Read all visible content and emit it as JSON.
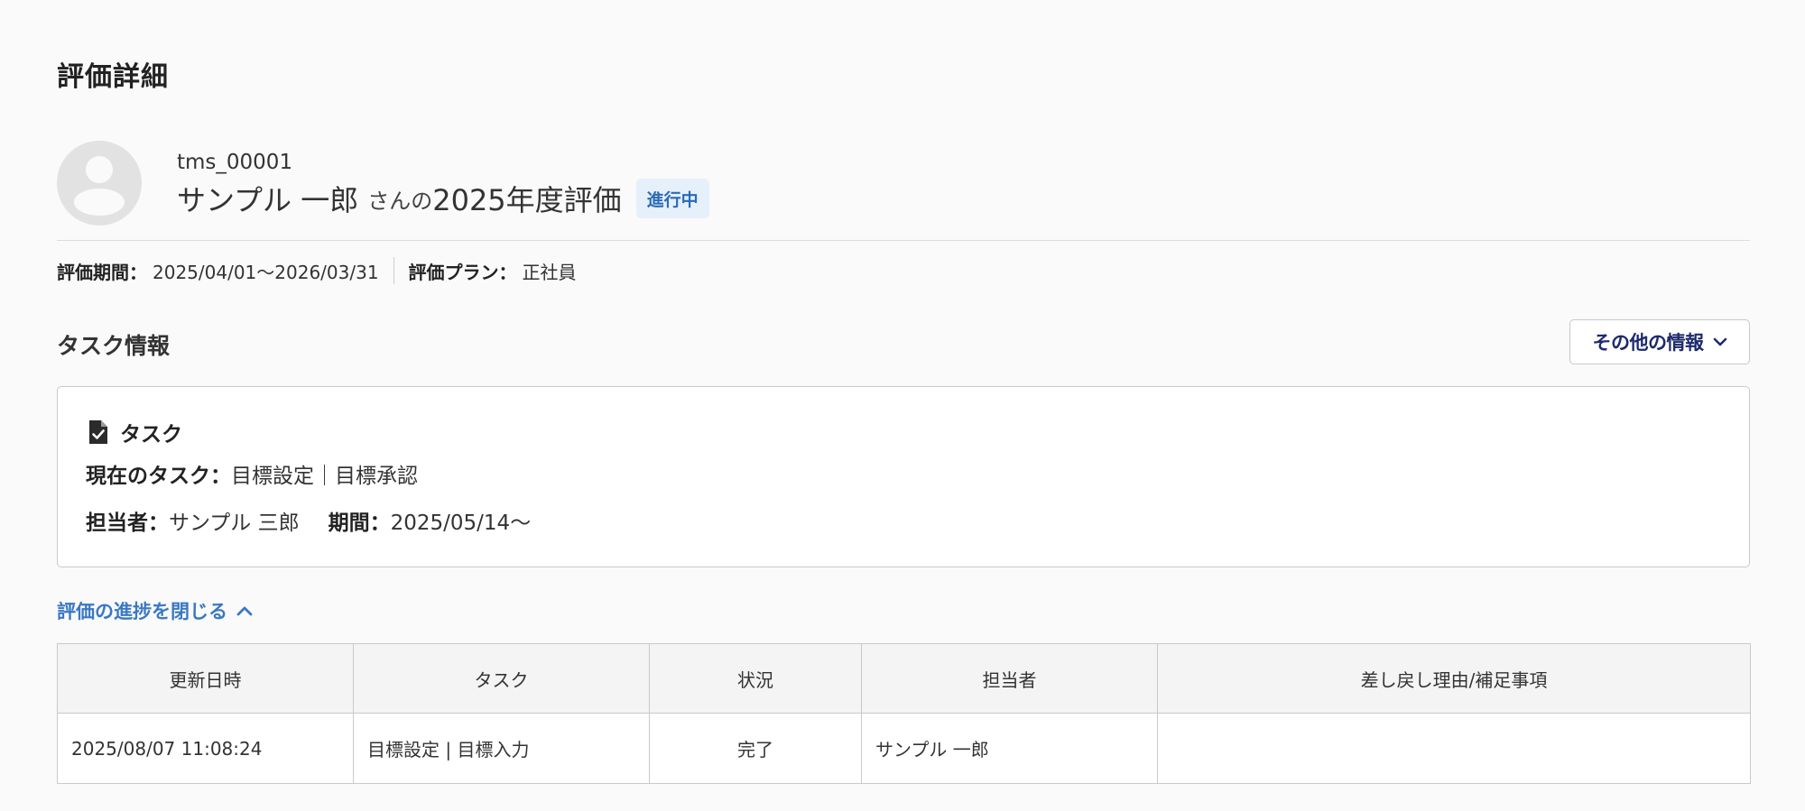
{
  "page": {
    "title": "評価詳細"
  },
  "employee": {
    "id": "tms_00001",
    "name": "サンプル 一郎",
    "suffix": "さんの",
    "eval_year": "2025年度評価",
    "status": "進行中"
  },
  "meta": {
    "period_label": "評価期間：",
    "period_value": "2025/04/01～2026/03/31",
    "plan_label": "評価プラン：",
    "plan_value": "正社員"
  },
  "task_section": {
    "title": "タスク情報",
    "other_info_button": "その他の情報"
  },
  "task_card": {
    "title": "タスク",
    "current_task_label": "現在のタスク：",
    "current_task_value": "目標設定｜目標承認",
    "assignee_label": "担当者：",
    "assignee_value": "サンプル 三郎",
    "period_label": "期間：",
    "period_value": "2025/05/14～"
  },
  "progress": {
    "toggle_label": "評価の進捗を閉じる",
    "columns": [
      "更新日時",
      "タスク",
      "状況",
      "担当者",
      "差し戻し理由/補足事項"
    ],
    "rows": [
      [
        "2025/08/07 11:08:24",
        "目標設定 | 目標入力",
        "完了",
        "サンプル 一郎",
        ""
      ]
    ]
  },
  "colors": {
    "accent": "#3a78c3",
    "status_badge_bg": "#e6f0fa",
    "status_badge_text": "#2a6ab8",
    "button_text": "#1d2a6b"
  }
}
